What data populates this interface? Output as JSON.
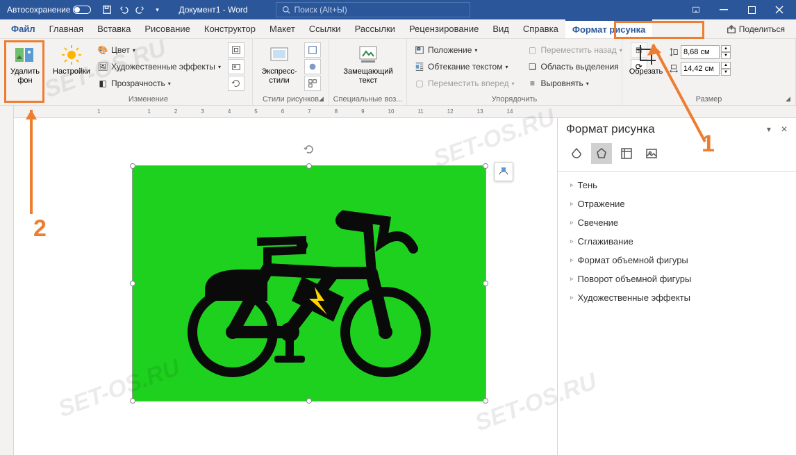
{
  "titlebar": {
    "autosave_label": "Автосохранение",
    "doc_title": "Документ1 - Word",
    "search_placeholder": "Поиск (Alt+Ы)"
  },
  "tabs": {
    "file": "Файл",
    "home": "Главная",
    "insert": "Вставка",
    "draw": "Рисование",
    "design": "Конструктор",
    "layout": "Макет",
    "references": "Ссылки",
    "mailings": "Рассылки",
    "review": "Рецензирование",
    "view": "Вид",
    "help": "Справка",
    "format": "Формат рисунка",
    "share": "Поделиться"
  },
  "ribbon": {
    "remove_bg": "Удалить фон",
    "corrections": "Настройки",
    "color": "Цвет",
    "artistic": "Художественные эффекты",
    "transparency": "Прозрачность",
    "group_adjust": "Изменение",
    "express_styles": "Экспресс-стили",
    "group_styles": "Стили рисунков",
    "alt_text": "Замещающий текст",
    "group_alt": "Специальные воз...",
    "position": "Положение",
    "wrap": "Обтекание текстом",
    "forward": "Переместить вперед",
    "backward": "Переместить назад",
    "selection_pane": "Область выделения",
    "align": "Выровнять",
    "group_arrange": "Упорядочить",
    "crop": "Обрезать",
    "height": "8,68 см",
    "width": "14,42 см",
    "group_size": "Размер"
  },
  "pane": {
    "title": "Формат рисунка",
    "sections": {
      "shadow": "Тень",
      "reflection": "Отражение",
      "glow": "Свечение",
      "soft_edges": "Сглаживание",
      "3d_format": "Формат объемной фигуры",
      "3d_rotation": "Поворот объемной фигуры",
      "artistic": "Художественные эффекты"
    }
  },
  "ruler": [
    "1",
    "",
    "1",
    "2",
    "3",
    "4",
    "5",
    "6",
    "7",
    "8",
    "9",
    "10",
    "11",
    "12",
    "13",
    "14"
  ],
  "annotations": {
    "num1": "1",
    "num2": "2"
  },
  "watermark": "SET-OS.RU"
}
